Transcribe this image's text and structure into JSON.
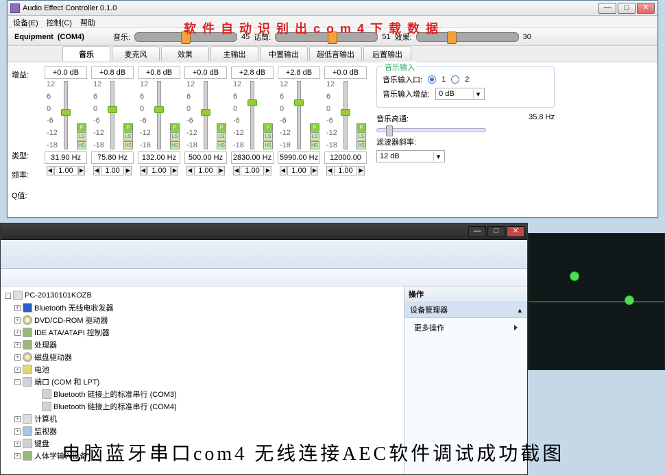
{
  "win1": {
    "title": "Audio Effect Controller 0.1.0",
    "menu": {
      "m1": "设备(E)",
      "m2": "控制(C)",
      "m3": "帮助"
    },
    "winbtns": {
      "min": "—",
      "max": "□",
      "close": "✕"
    },
    "params": {
      "equip_label": "Equipment",
      "equip_port": "(COM4)",
      "music_label": "音乐:",
      "music_val": "45",
      "mic_label": "话筒:",
      "mic_val": "51",
      "fx_label": "效果:",
      "fx_val": "30"
    },
    "tabs": [
      "音乐",
      "麦克风",
      "效果",
      "主输出",
      "中置输出",
      "超低音输出",
      "后置输出"
    ],
    "leftlabels": {
      "gain": "增益:",
      "type": "类型:",
      "freq": "频率:",
      "q": "Q值:"
    },
    "ticks": [
      "12",
      "6",
      "0",
      "-6",
      "-12",
      "-18"
    ],
    "typebtns": {
      "p": "P",
      "ls": "LS",
      "hs": "HS"
    },
    "qarrow": {
      "left": "◀",
      "right": "▶"
    }
  },
  "channels": [
    {
      "gain": "+0.0 dB",
      "thumb": 40,
      "freq": "31.90 Hz",
      "q": "1.00"
    },
    {
      "gain": "+0.8 dB",
      "thumb": 36,
      "freq": "75.80 Hz",
      "q": "1.00"
    },
    {
      "gain": "+0.8 dB",
      "thumb": 36,
      "freq": "132.00 Hz",
      "q": "1.00"
    },
    {
      "gain": "+0.0 dB",
      "thumb": 40,
      "freq": "500.00 Hz",
      "q": "1.00"
    },
    {
      "gain": "+2.8 dB",
      "thumb": 26,
      "freq": "2830.00 Hz",
      "q": "1.00"
    },
    {
      "gain": "+2.8 dB",
      "thumb": 26,
      "freq": "5990.00 Hz",
      "q": "1.00"
    },
    {
      "gain": "+0.0 dB",
      "thumb": 40,
      "freq": "12000.00 Hz",
      "q": "1.00"
    }
  ],
  "right": {
    "group_title": "音乐输入",
    "port_label": "音乐输入口:",
    "opt1": "1",
    "opt2": "2",
    "gain_label": "音乐输入增益:",
    "gain_val": "0 dB",
    "hp_label": "音乐高通:",
    "hp_val": "35.8 Hz",
    "slope_label": "滤波器斜率:",
    "slope_val": "12 dB"
  },
  "anno": {
    "top": "软 件 自 动 识 别 出 c o m 4 下 载 数 据"
  },
  "win2": {
    "winbtns": {
      "min": "—",
      "max": "□",
      "close": "✕"
    },
    "root": "PC-20130101KOZB",
    "nodes": [
      {
        "icon": "bt",
        "label": "Bluetooth 无线电收发器"
      },
      {
        "icon": "disc",
        "label": "DVD/CD-ROM 驱动器"
      },
      {
        "icon": "chip",
        "label": "IDE ATA/ATAPI 控制器"
      },
      {
        "icon": "chip",
        "label": "处理器"
      },
      {
        "icon": "disc",
        "label": "磁盘驱动器"
      },
      {
        "icon": "batt",
        "label": "电池"
      }
    ],
    "ports_label": "端口 (COM 和 LPT)",
    "com3": "Bluetooth 链接上的标准串行 (COM3)",
    "com4": "Bluetooth 链接上的标准串行 (COM4)",
    "tail": [
      {
        "icon": "pc",
        "label": "计算机"
      },
      {
        "icon": "mon",
        "label": "监视器"
      },
      {
        "icon": "kb",
        "label": "键盘"
      },
      {
        "icon": "chip",
        "label": "人体学输入设备"
      }
    ],
    "actions": {
      "hdr": "操作",
      "sub": "设备管理器",
      "more": "更多操作"
    }
  },
  "caption": "电脑蓝牙串口com4  无线连接AEC软件调试成功截图"
}
